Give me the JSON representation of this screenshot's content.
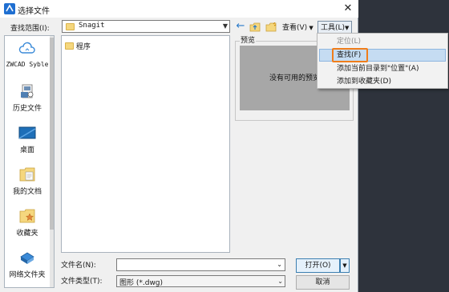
{
  "window": {
    "title": "选择文件",
    "close_glyph": "✕"
  },
  "lookin": {
    "label": "查找范围(I):",
    "value": "Snagit"
  },
  "toolbar": {
    "back_icon": "back-arrow-icon",
    "up_icon": "folder-up-icon",
    "newfolder_icon": "new-folder-icon",
    "view_label": "查看(V)",
    "tools_label": "工具(L)"
  },
  "sidebar": {
    "items": [
      {
        "label": "ZWCAD Syble",
        "icon": "cloud-icon"
      },
      {
        "label": "历史文件",
        "icon": "history-icon"
      },
      {
        "label": "桌面",
        "icon": "desktop-icon"
      },
      {
        "label": "我的文档",
        "icon": "documents-icon"
      },
      {
        "label": "收藏夹",
        "icon": "favorites-icon"
      },
      {
        "label": "网络文件夹",
        "icon": "network-icon"
      }
    ]
  },
  "filelist": {
    "items": [
      {
        "name": "程序",
        "icon": "folder-icon"
      }
    ]
  },
  "preview": {
    "label": "预览",
    "empty_text": "没有可用的预览"
  },
  "tools_menu": {
    "items": [
      {
        "label": "定位(L)",
        "disabled": true
      },
      {
        "label": "查找(F)",
        "highlighted": true
      },
      {
        "label": "添加当前目录到\"位置\"(A)"
      },
      {
        "label": "添加到收藏夹(D)"
      }
    ]
  },
  "bottom": {
    "filename_label": "文件名(N):",
    "filename_value": "",
    "filetype_label": "文件类型(T):",
    "filetype_value": "图形 (*.dwg)",
    "open_label": "打开(O)",
    "cancel_label": "取消"
  },
  "colors": {
    "accent_highlight": "#c5dcf2",
    "annotation_orange": "#f07d1a",
    "backdrop": "#2e333c"
  }
}
